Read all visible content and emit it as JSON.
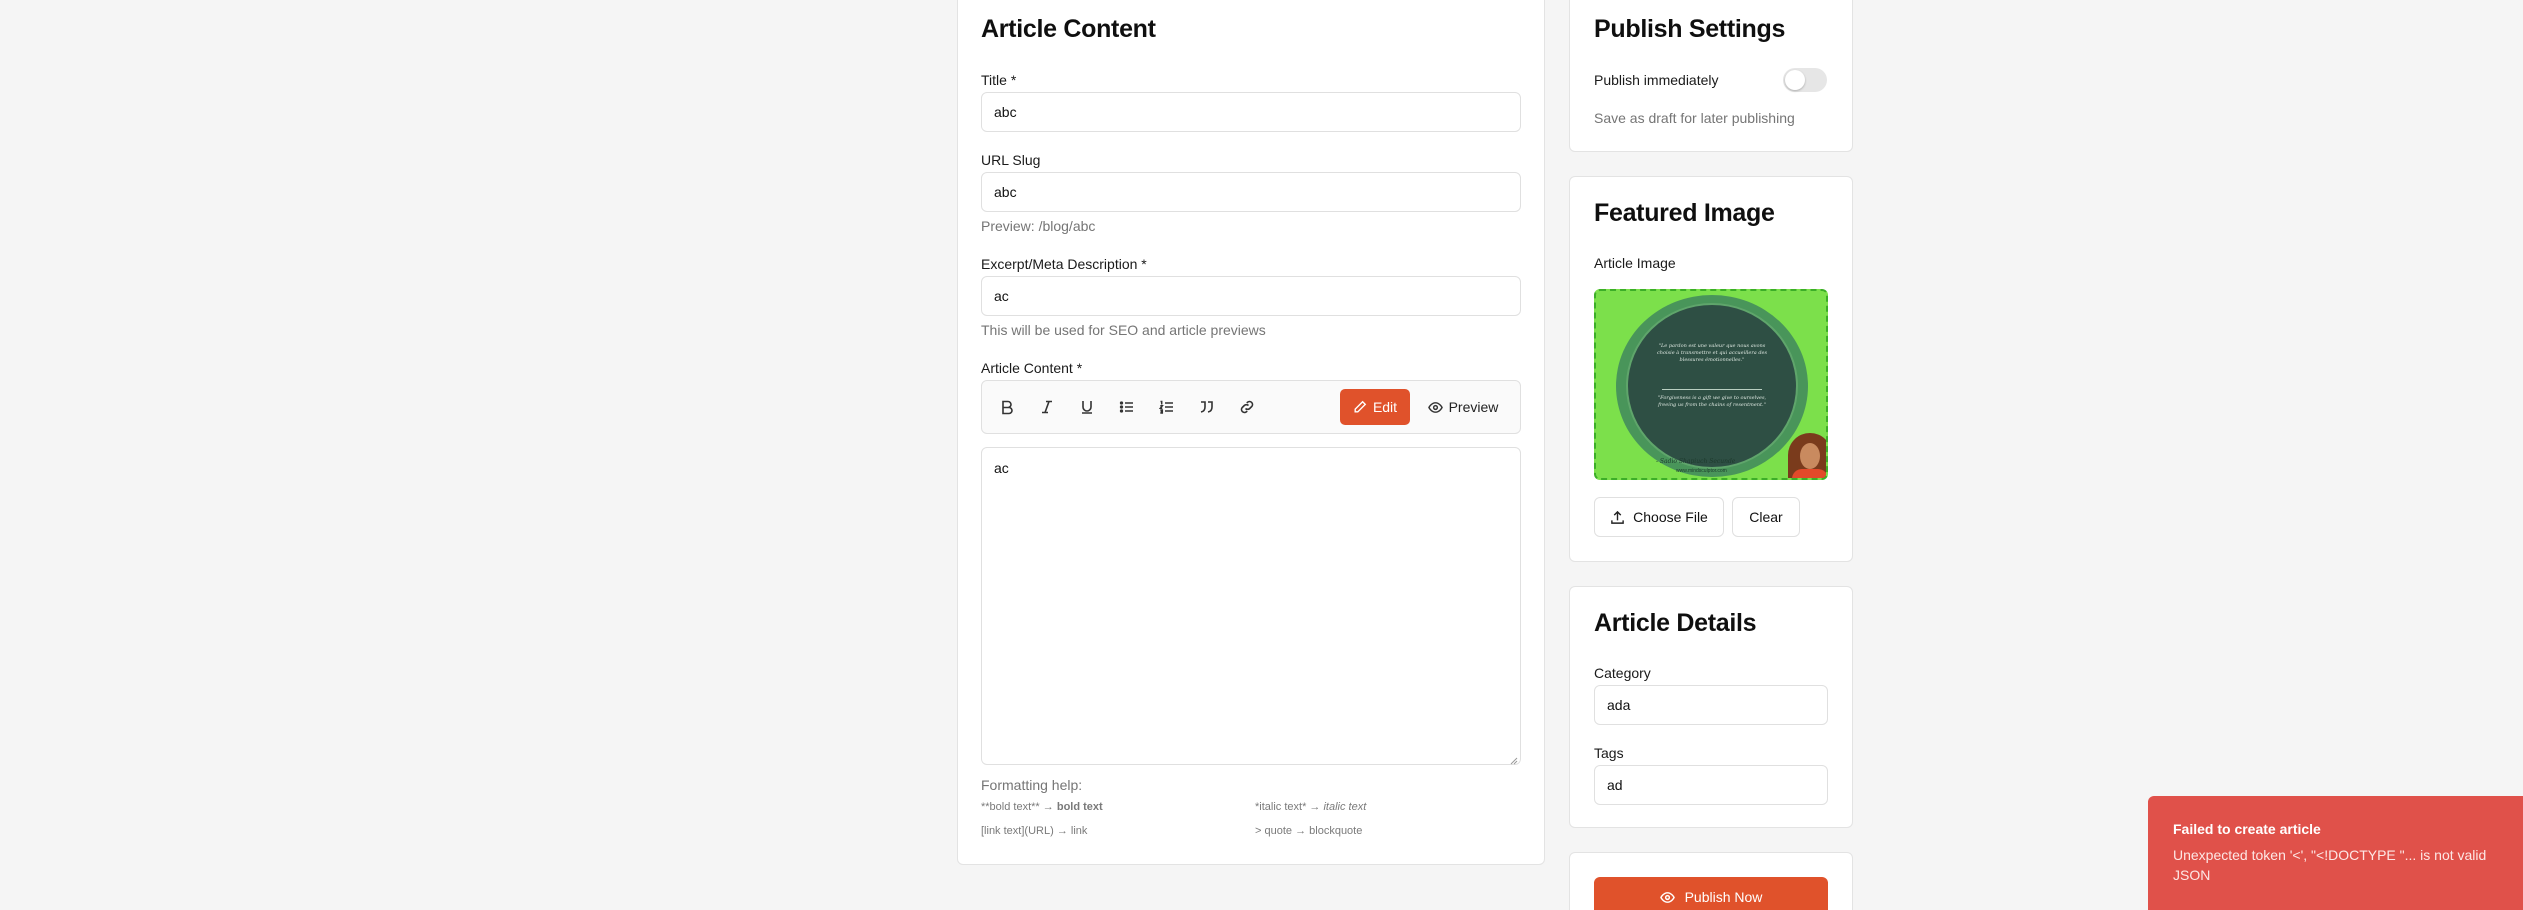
{
  "article_content": {
    "heading": "Article Content",
    "title_label": "Title *",
    "title_value": "abc",
    "slug_label": "URL Slug",
    "slug_value": "abc",
    "slug_preview": "Preview: /blog/abc",
    "excerpt_label": "Excerpt/Meta Description *",
    "excerpt_value": "ac",
    "excerpt_hint": "This will be used for SEO and article previews",
    "content_label": "Article Content *",
    "content_value": "ac",
    "toolbar": {
      "edit_label": "Edit",
      "preview_label": "Preview",
      "icons": [
        "bold-icon",
        "italic-icon",
        "underline-icon",
        "bullet-list-icon",
        "numbered-list-icon",
        "quote-icon",
        "link-icon"
      ]
    },
    "help": {
      "title": "Formatting help:",
      "bold_syntax": "**bold text**",
      "bold_result": "bold text",
      "italic_syntax": "*italic text*",
      "italic_result": "italic text",
      "link_syntax": "[link text](URL)",
      "link_result": "link",
      "quote_syntax": "> quote",
      "quote_result": "blockquote",
      "arrow": "→"
    }
  },
  "publish_settings": {
    "heading": "Publish Settings",
    "toggle_label": "Publish immediately",
    "toggle_on": false,
    "hint": "Save as draft for later publishing"
  },
  "featured_image": {
    "heading": "Featured Image",
    "label": "Article Image",
    "choose_label": "Choose File",
    "clear_label": "Clear",
    "image_text": {
      "quote_1": "\"Le pardon est une valeur que nous avons choisie à transmettre et qui accueillera des blessures émotionnelles.\"",
      "quote_2": "\"Forgiveness is a gift we give to ourselves, freeing us from the chains of resentment.\"",
      "signature": "- Sadio Shapiuch Secunde",
      "website": "www.mindsculptor.com"
    }
  },
  "article_details": {
    "heading": "Article Details",
    "category_label": "Category",
    "category_value": "ada",
    "tags_label": "Tags",
    "tags_value": "ad"
  },
  "actions": {
    "publish_label": "Publish Now"
  },
  "toast": {
    "title": "Failed to create article",
    "message": "Unexpected token '<', \"<!DOCTYPE \"... is not valid JSON"
  },
  "colors": {
    "accent": "#e0522b",
    "toast_bg": "#e0514a",
    "image_green": "#7ce04b",
    "image_dark": "#2e4f44"
  }
}
